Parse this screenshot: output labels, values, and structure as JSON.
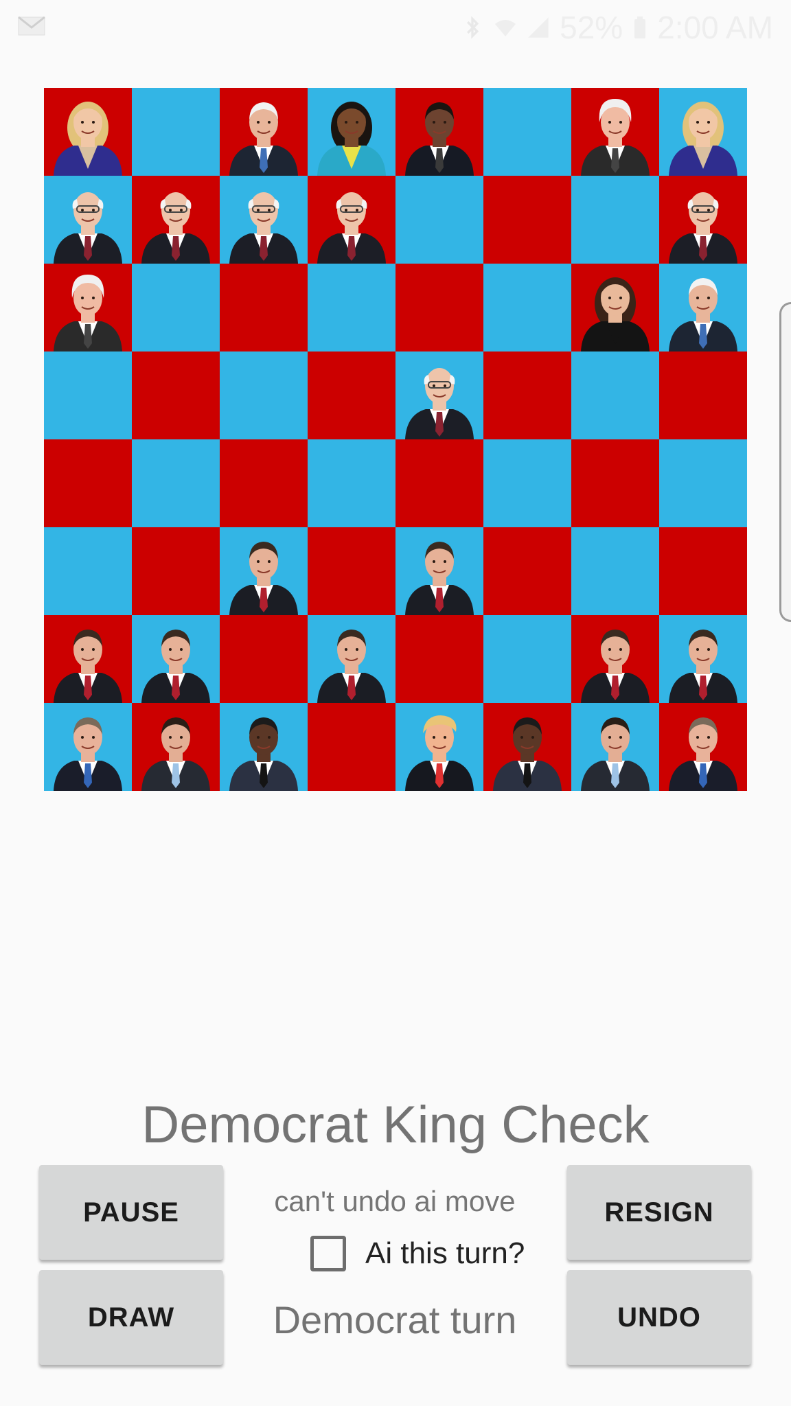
{
  "status_bar": {
    "battery": "52%",
    "time": "2:00 AM",
    "icons": [
      "mail-icon",
      "bluetooth-icon",
      "wifi-icon",
      "signal-icon",
      "battery-icon"
    ]
  },
  "board": {
    "colors": {
      "red": "#cc0000",
      "blue": "#33b5e5"
    },
    "first_square": "red",
    "rows": [
      [
        "hillary",
        "",
        "biden",
        "michelle",
        "obama",
        "",
        "bill",
        "hillary"
      ],
      [
        "bernie",
        "bernie",
        "bernie",
        "bernie",
        "",
        "",
        "",
        "bernie"
      ],
      [
        "bill",
        "",
        "",
        "",
        "",
        "",
        "palin",
        "biden"
      ],
      [
        "",
        "",
        "",
        "",
        "bernie",
        "",
        "",
        ""
      ],
      [
        "",
        "",
        "",
        "",
        "",
        "",
        "",
        ""
      ],
      [
        "",
        "",
        "christie",
        "",
        "christie",
        "",
        "",
        ""
      ],
      [
        "christie",
        "christie",
        "",
        "christie",
        "",
        "",
        "christie",
        "christie"
      ],
      [
        "bush",
        "cruz",
        "carson",
        "",
        "trump",
        "carson",
        "cruz",
        "bush"
      ]
    ]
  },
  "game": {
    "title": "Democrat King Check",
    "note": "can't undo ai move",
    "ai_label": "Ai this turn?",
    "ai_checked": false,
    "turn": "Democrat turn"
  },
  "buttons": {
    "pause": "PAUSE",
    "resign": "RESIGN",
    "draw": "DRAW",
    "undo": "UNDO"
  }
}
